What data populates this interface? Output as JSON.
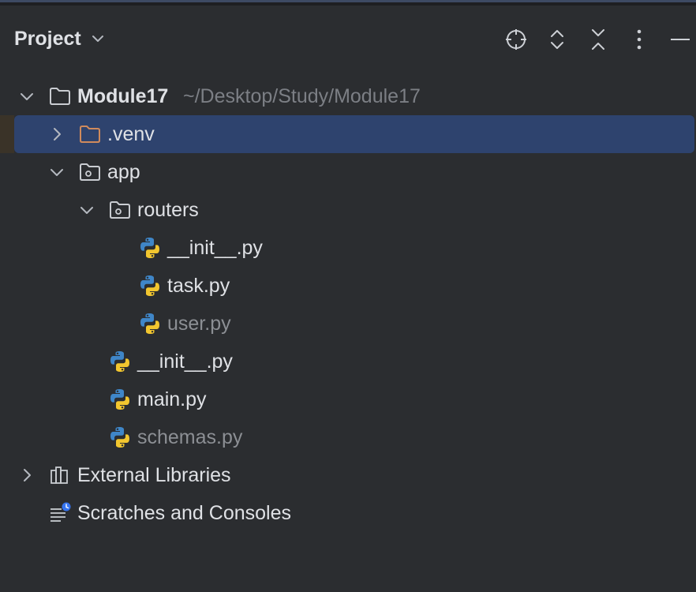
{
  "header": {
    "title": "Project"
  },
  "toolbar": {
    "icons": [
      "locate-icon",
      "expand-all-icon",
      "collapse-all-icon",
      "more-options-icon",
      "hide-icon"
    ]
  },
  "tree": {
    "root": {
      "label": "Module17",
      "path": "~/Desktop/Study/Module17"
    },
    "venv": {
      "label": ".venv"
    },
    "app": {
      "label": "app"
    },
    "routers": {
      "label": "routers"
    },
    "routers_init": {
      "label": "__init__.py"
    },
    "task": {
      "label": "task.py"
    },
    "user": {
      "label": "user.py"
    },
    "app_init": {
      "label": "__init__.py"
    },
    "main": {
      "label": "main.py"
    },
    "schemas": {
      "label": "schemas.py"
    },
    "external": {
      "label": "External Libraries"
    },
    "scratches": {
      "label": "Scratches and Consoles"
    }
  },
  "colors": {
    "background": "#2b2d30",
    "selection": "#2e436e",
    "text": "#dfe1e5",
    "dim_text": "#8c8f94",
    "venv_folder": "#d08a5c",
    "python_blue": "#3f86c8",
    "python_yellow": "#f2c62f",
    "scratch_badge": "#3574f0"
  }
}
